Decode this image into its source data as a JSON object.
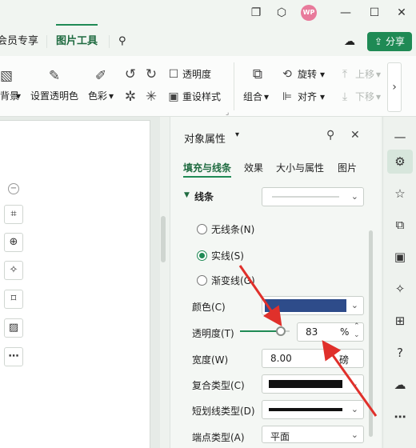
{
  "titlebar": {
    "avatar_text": "WP",
    "icons": [
      "window-icon",
      "cube-icon",
      "avatar",
      "minimize-icon",
      "maximize-icon",
      "close-icon"
    ]
  },
  "menu": {
    "member": "会员专享",
    "picture_tools": "图片工具",
    "share": "分享"
  },
  "ribbon": {
    "bg_partial": "背景",
    "set_transparent": "设置透明色",
    "color": "色彩",
    "transparency": "透明度",
    "reset_style": "重设样式",
    "group": "组合",
    "rotate": "旋转",
    "align": "对齐",
    "move_up": "上移",
    "move_down": "下移"
  },
  "panel": {
    "title": "对象属性",
    "tabs": [
      "填充与线条",
      "效果",
      "大小与属性",
      "图片"
    ],
    "section": "线条",
    "radio_options": [
      "无线条(N)",
      "实线(S)",
      "渐变线(G)"
    ],
    "selected_radio": 1,
    "color_label": "颜色(C)",
    "line_color": "#2e4c8a",
    "transparency_label": "透明度(T)",
    "transparency_value": "83",
    "transparency_unit": "%",
    "transparency_level": 0.83,
    "width_label": "宽度(W)",
    "width_value": "8.00",
    "width_unit": "磅",
    "compound_label": "复合类型(C)",
    "dash_label": "短划线类型(D)",
    "cap_label": "端点类型(A)",
    "cap_value": "平面"
  },
  "colors": {
    "accent": "#1f8a55",
    "arrow": "#e0302b"
  }
}
